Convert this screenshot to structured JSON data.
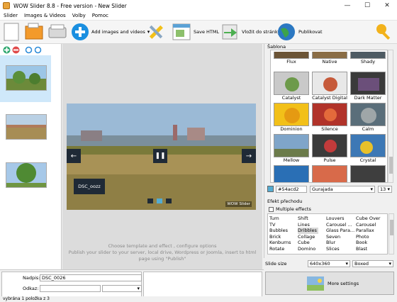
{
  "window": {
    "title": "WOW Slider 8.8 - Free version - New Slider"
  },
  "menu": [
    "Slider",
    "Images & Videos",
    "Volby",
    "Pomoc"
  ],
  "toolbar": {
    "add_label": "Add images and videos",
    "save_html_label": "Save HTML",
    "export_label": "Vložit do stránky",
    "publish_label": "Publikovat"
  },
  "template": {
    "section_label": "Šablona",
    "items": [
      "Flux",
      "Native",
      "Shady",
      "Catalyst",
      "Catalyst Digital",
      "Dark Matter",
      "Dominion",
      "Silence",
      "Calm",
      "Mellow",
      "Pulse",
      "Crystal"
    ],
    "color_value": "#54acd2",
    "font_value": "Gurajada",
    "font_size": "13"
  },
  "effects": {
    "section_label": "Efekt přechodu",
    "multiple_label": "Multiple effects",
    "columns": [
      [
        "Turn",
        "TV",
        "Bubbles",
        "Brick",
        "Kenburns",
        "Rotate"
      ],
      [
        "Shift",
        "Lines",
        "Dribbles",
        "Collage",
        "Cube",
        "Domino"
      ],
      [
        "Louvers",
        "Carousel ...",
        "Glass Para...",
        "Seven",
        "Blur",
        "Slices"
      ],
      [
        "Cube Over",
        "Carousel",
        "Parallax",
        "Photo",
        "Book",
        "Blast"
      ]
    ],
    "selected": "Dribbles"
  },
  "slide_size": {
    "label": "Slide size",
    "value": "640x360",
    "mode": "Boxed"
  },
  "more_settings_label": "More settings",
  "preview": {
    "caption": "DSC_oozz",
    "watermark": "WOW Slider"
  },
  "hint": {
    "line1": "Choose template and effect , configure options",
    "line2": "Publish your slider to your server, local drive, Wordpress or Joomla, insert to html",
    "line3": "page using \"Publish\""
  },
  "properties": {
    "title_label": "Nadpis:",
    "title_value": "DSC_0026",
    "link_label": "Odkaz:",
    "link_value": ""
  },
  "status": "vybrána 1 položka z 3",
  "colors": {
    "accent": "#1a8fe0",
    "swatch": "#54acd2"
  }
}
